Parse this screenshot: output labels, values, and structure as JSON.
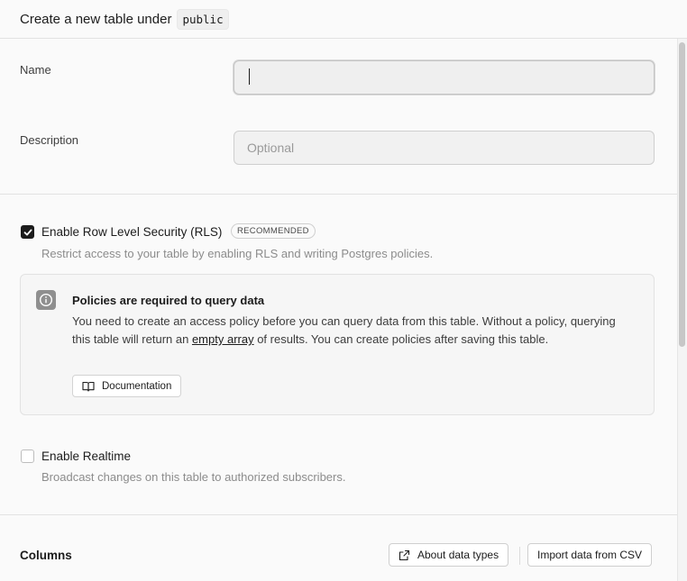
{
  "header": {
    "title": "Create a new table under",
    "schema": "public"
  },
  "form": {
    "name_label": "Name",
    "name_value": "",
    "description_label": "Description",
    "description_placeholder": "Optional"
  },
  "rls": {
    "label": "Enable Row Level Security (RLS)",
    "badge": "RECOMMENDED",
    "description": "Restrict access to your table by enabling RLS and writing Postgres policies.",
    "checked": true,
    "alert": {
      "icon": "info-icon",
      "title": "Policies are required to query data",
      "body_before": "You need to create an access policy before you can query data from this table. Without a policy, querying this table will return an ",
      "body_link": "empty array",
      "body_after": " of results. You can create policies after saving this table.",
      "button_label": "Documentation",
      "button_icon": "book-icon"
    }
  },
  "realtime": {
    "label": "Enable Realtime",
    "description": "Broadcast changes on this table to authorized subscribers.",
    "checked": false
  },
  "columns": {
    "title": "Columns",
    "about_button": "About data types",
    "about_icon": "external-link-icon",
    "import_button": "Import data from CSV"
  }
}
